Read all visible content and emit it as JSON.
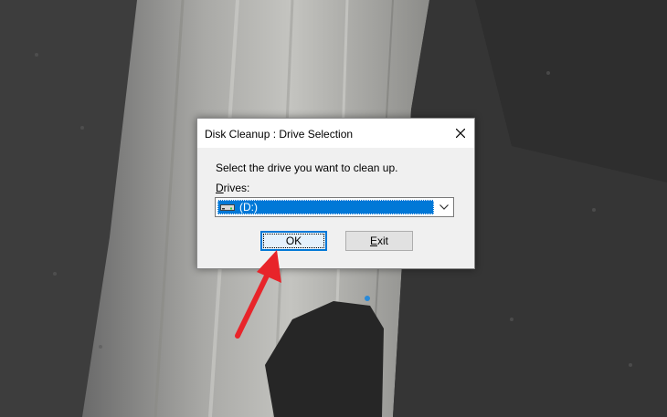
{
  "dialog": {
    "title": "Disk Cleanup : Drive Selection",
    "close_icon": "close-icon",
    "prompt": "Select the drive you want to clean up.",
    "drives_label_mnemonic": "D",
    "drives_label_rest": "rives:",
    "selected_drive": "(D:)",
    "drive_icon": "drive-icon",
    "dropdown_icon": "chevron-down-icon",
    "ok_label": "OK",
    "exit_label_mnemonic": "E",
    "exit_label_rest": "xit"
  },
  "annotation": {
    "arrow_icon": "red-arrow-icon",
    "color": "#e8242a"
  },
  "colors": {
    "selection": "#0078d7",
    "dialog_bg": "#f0f0f0",
    "titlebar_bg": "#ffffff"
  }
}
